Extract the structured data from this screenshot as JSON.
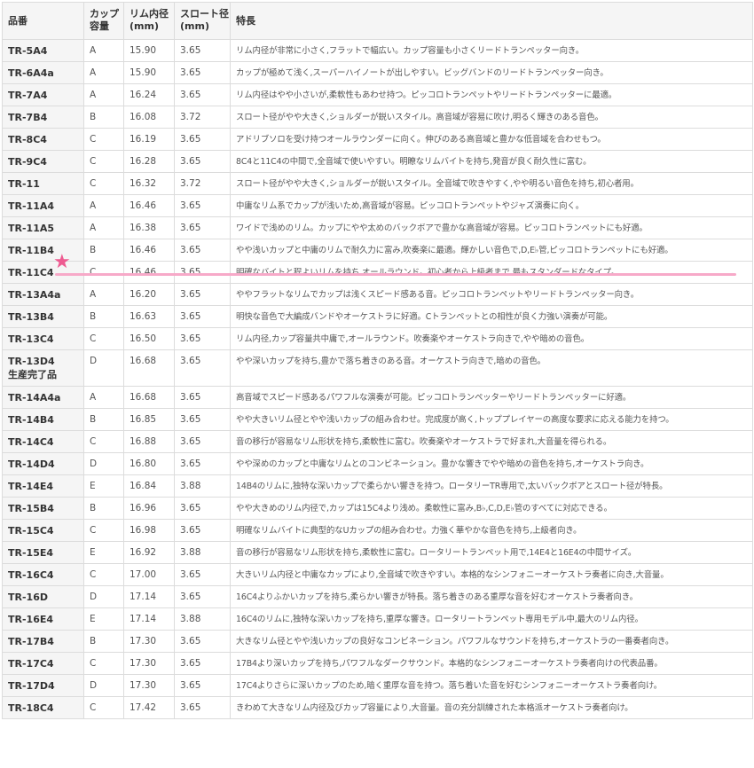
{
  "headers": {
    "model": "品番",
    "cup_l1": "カップ",
    "cup_l2": "容量",
    "rim_l1": "リム内径",
    "rim_l2": "(mm)",
    "throat_l1": "スロート径",
    "throat_l2": "(mm)",
    "feature": "特長"
  },
  "highlight": {
    "marker": "★"
  },
  "rows": [
    {
      "model": "TR-5A4",
      "cup": "A",
      "rim": "15.90",
      "throat": "3.65",
      "feature": "リム内径が非常に小さく,フラットで幅広い。カップ容量も小さくリードトランペッター向き。"
    },
    {
      "model": "TR-6A4a",
      "cup": "A",
      "rim": "15.90",
      "throat": "3.65",
      "feature": "カップが極めて浅く,スーパーハイノートが出しやすい。ビッグバンドのリードトランペッター向き。"
    },
    {
      "model": "TR-7A4",
      "cup": "A",
      "rim": "16.24",
      "throat": "3.65",
      "feature": "リム内径はやや小さいが,柔軟性もあわせ持つ。ピッコロトランペットやリードトランペッターに最適。"
    },
    {
      "model": "TR-7B4",
      "cup": "B",
      "rim": "16.08",
      "throat": "3.72",
      "feature": "スロート径がやや大きく,ショルダーが鋭いスタイル。高音域が容易に吹け,明るく輝きのある音色。"
    },
    {
      "model": "TR-8C4",
      "cup": "C",
      "rim": "16.19",
      "throat": "3.65",
      "feature": "アドリブソロを受け持つオールラウンダーに向く。伸びのある高音域と豊かな低音域を合わせもつ。"
    },
    {
      "model": "TR-9C4",
      "cup": "C",
      "rim": "16.28",
      "throat": "3.65",
      "feature": "8C4と11C4の中間で,全音域で使いやすい。明瞭なリムバイトを持ち,発音が良く耐久性に富む。"
    },
    {
      "model": "TR-11",
      "cup": "C",
      "rim": "16.32",
      "throat": "3.72",
      "feature": "スロート径がやや大きく,ショルダーが鋭いスタイル。全音域で吹きやすく,やや明るい音色を持ち,初心者用。"
    },
    {
      "model": "TR-11A4",
      "cup": "A",
      "rim": "16.46",
      "throat": "3.65",
      "feature": "中庸なリム系でカップが浅いため,高音域が容易。ピッコロトランペットやジャズ演奏に向く。"
    },
    {
      "model": "TR-11A5",
      "cup": "A",
      "rim": "16.38",
      "throat": "3.65",
      "feature": "ワイドで浅めのリム。カップにやや太めのバックボアで豊かな高音域が容易。ピッコロトランペットにも好適。"
    },
    {
      "model": "TR-11B4",
      "cup": "B",
      "rim": "16.46",
      "throat": "3.65",
      "feature": "やや浅いカップと中庸のリムで耐久力に富み,吹奏楽に最適。輝かしい音色で,D,E♭管,ピッコロトランペットにも好適。"
    },
    {
      "model": "TR-11C4",
      "cup": "C",
      "rim": "16.46",
      "throat": "3.65",
      "feature": "明確なバイトと程よいリムを持ち,オールラウンド。初心者から上級者まで,最もスタンダードなタイプ。"
    },
    {
      "model": "TR-13A4a",
      "cup": "A",
      "rim": "16.20",
      "throat": "3.65",
      "feature": "ややフラットなリムでカップは浅くスピード感ある音。ピッコロトランペットやリードトランペッター向き。"
    },
    {
      "model": "TR-13B4",
      "cup": "B",
      "rim": "16.63",
      "throat": "3.65",
      "feature": "明快な音色で大編成バンドやオーケストラに好適。Cトランペットとの相性が良く力強い演奏が可能。"
    },
    {
      "model": "TR-13C4",
      "cup": "C",
      "rim": "16.50",
      "throat": "3.65",
      "feature": "リム内径,カップ容量共中庸で,オールラウンド。吹奏楽やオーケストラ向きで,やや暗めの音色。"
    },
    {
      "model": "TR-13D4",
      "model_note": "生産完了品",
      "cup": "D",
      "rim": "16.68",
      "throat": "3.65",
      "feature": "やや深いカップを持ち,豊かで落ち着きのある音。オーケストラ向きで,暗めの音色。"
    },
    {
      "model": "TR-14A4a",
      "cup": "A",
      "rim": "16.68",
      "throat": "3.65",
      "feature": "高音域でスピード感あるパワフルな演奏が可能。ピッコロトランペッターやリードトランペッターに好適。"
    },
    {
      "model": "TR-14B4",
      "cup": "B",
      "rim": "16.85",
      "throat": "3.65",
      "feature": "やや大きいリム径とやや浅いカップの組み合わせ。完成度が高く,トッププレイヤーの高度な要求に応える能力を持つ。"
    },
    {
      "model": "TR-14C4",
      "cup": "C",
      "rim": "16.88",
      "throat": "3.65",
      "feature": "音の移行が容易なリム形状を持ち,柔軟性に富む。吹奏楽やオーケストラで好まれ,大音量を得られる。"
    },
    {
      "model": "TR-14D4",
      "cup": "D",
      "rim": "16.80",
      "throat": "3.65",
      "feature": "やや深めのカップと中庸なリムとのコンビネーション。豊かな響きでやや暗めの音色を持ち,オーケストラ向き。"
    },
    {
      "model": "TR-14E4",
      "cup": "E",
      "rim": "16.84",
      "throat": "3.88",
      "feature": "14B4のリムに,独特な深いカップで柔らかい響きを持つ。ロータリーTR専用で,太いバックボアとスロート径が特長。"
    },
    {
      "model": "TR-15B4",
      "cup": "B",
      "rim": "16.96",
      "throat": "3.65",
      "feature": "やや大きめのリム内径で,カップは15C4より浅め。柔軟性に富み,B♭,C,D,E♭管のすべてに対応できる。"
    },
    {
      "model": "TR-15C4",
      "cup": "C",
      "rim": "16.98",
      "throat": "3.65",
      "feature": "明確なリムバイトに典型的なUカップの組み合わせ。力強く華やかな音色を持ち,上級者向き。"
    },
    {
      "model": "TR-15E4",
      "cup": "E",
      "rim": "16.92",
      "throat": "3.88",
      "feature": "音の移行が容易なリム形状を持ち,柔軟性に富む。ロータリートランペット用で,14E4と16E4の中間サイズ。"
    },
    {
      "model": "TR-16C4",
      "cup": "C",
      "rim": "17.00",
      "throat": "3.65",
      "feature": "大きいリム内径と中庸なカップにより,全音域で吹きやすい。本格的なシンフォニーオーケストラ奏者に向き,大音量。"
    },
    {
      "model": "TR-16D",
      "cup": "D",
      "rim": "17.14",
      "throat": "3.65",
      "feature": "16C4よりふかいカップを持ち,柔らかい響きが特長。落ち着きのある重厚な音を好むオーケストラ奏者向き。"
    },
    {
      "model": "TR-16E4",
      "cup": "E",
      "rim": "17.14",
      "throat": "3.88",
      "feature": "16C4のリムに,独特な深いカップを持ち,重厚な響き。ロータリートランペット専用モデル中,最大のリム内径。"
    },
    {
      "model": "TR-17B4",
      "cup": "B",
      "rim": "17.30",
      "throat": "3.65",
      "feature": "大きなリム径とやや浅いカップの良好なコンビネーション。パワフルなサウンドを持ち,オーケストラの一番奏者向き。"
    },
    {
      "model": "TR-17C4",
      "cup": "C",
      "rim": "17.30",
      "throat": "3.65",
      "feature": "17B4より深いカップを持ち,パワフルなダークサウンド。本格的なシンフォニーオーケストラ奏者向けの代表品番。"
    },
    {
      "model": "TR-17D4",
      "cup": "D",
      "rim": "17.30",
      "throat": "3.65",
      "feature": "17C4よりさらに深いカップのため,暗く重厚な音を持つ。落ち着いた音を好むシンフォニーオーケストラ奏者向け。"
    },
    {
      "model": "TR-18C4",
      "cup": "C",
      "rim": "17.42",
      "throat": "3.65",
      "feature": "きわめて大きなリム内径及びカップ容量により,大音量。音の充分訓練された本格派オーケストラ奏者向け。"
    }
  ]
}
